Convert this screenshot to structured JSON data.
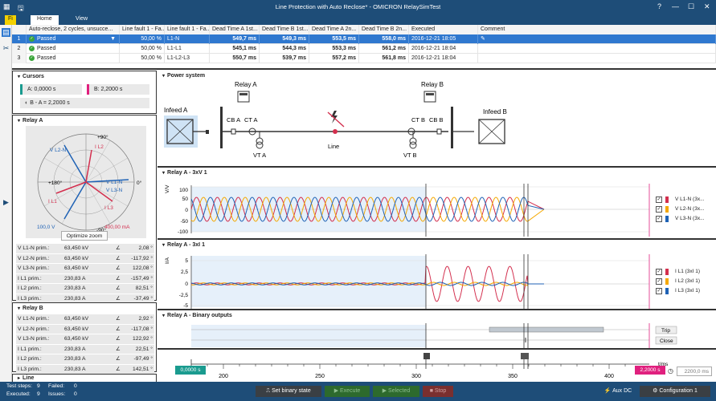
{
  "window": {
    "title": "Line Protection with Auto Reclose* - OMICRON RelaySimTest"
  },
  "ribbon": {
    "file": "Fi",
    "home": "Home",
    "view": "View",
    "file_hint": "F",
    "home_hint": "H",
    "view_hint": "V"
  },
  "grid": {
    "headers": [
      "Auto-reclose, 2 cycles, unsucce...",
      "Line fault 1 - Fa...",
      "Line fault 1 - Fa...",
      "Dead Time A 1st...",
      "Dead Time B 1st...",
      "Dead Time A 2n...",
      "Dead Time B 2n...",
      "Executed",
      "Comment"
    ],
    "rows": [
      {
        "num": "1",
        "status": "Passed",
        "c1": "50,00 %",
        "c2": "L1-N",
        "c3": "549,7 ms",
        "c4": "549,3 ms",
        "c5": "553,5 ms",
        "c6": "558,0 ms",
        "exec": "2016-12-21 18:05",
        "comment": ""
      },
      {
        "num": "2",
        "status": "Passed",
        "c1": "50,00 %",
        "c2": "L1-L1",
        "c3": "545,1 ms",
        "c4": "544,3 ms",
        "c5": "553,3 ms",
        "c6": "561,2 ms",
        "exec": "2016-12-21 18:04",
        "comment": ""
      },
      {
        "num": "3",
        "status": "Passed",
        "c1": "50,00 %",
        "c2": "L1-L2-L3",
        "c3": "550,7 ms",
        "c4": "539,7 ms",
        "c5": "557,2 ms",
        "c6": "561,8 ms",
        "exec": "2016-12-21 18:04",
        "comment": ""
      }
    ]
  },
  "cursors": {
    "title": "Cursors",
    "a": "A: 0,0000 s",
    "b": "B: 2,2000 s",
    "diff": "B - A = 2,2000 s"
  },
  "relay_a": {
    "title": "Relay A",
    "phasor": {
      "deg_0": "0°",
      "deg_90": "+90°",
      "deg_m90": "-90°",
      "deg_180": "+180°",
      "l1n": "V L1-N",
      "l2n": "V L2-N",
      "l3n": "V L3-N",
      "il1": "I L1",
      "il2": "I L2",
      "il3": "I L3",
      "vscale": "100,0 V",
      "iscale": "400,00 mA"
    },
    "optimize": "Optimize zoom",
    "values": [
      {
        "name": "V L1-N prim.:",
        "mag": "63,450 kV",
        "ang": "2,08 °"
      },
      {
        "name": "V L2-N prim.:",
        "mag": "63,450 kV",
        "ang": "-117,92 °"
      },
      {
        "name": "V L3-N prim.:",
        "mag": "63,450 kV",
        "ang": "122,08 °"
      },
      {
        "name": "I L1 prim.:",
        "mag": "230,83 A",
        "ang": "-157,49 °"
      },
      {
        "name": "I L2 prim.:",
        "mag": "230,83 A",
        "ang": "82,51 °"
      },
      {
        "name": "I L3 prim.:",
        "mag": "230,83 A",
        "ang": "-37,49 °"
      }
    ]
  },
  "relay_b": {
    "title": "Relay B",
    "values": [
      {
        "name": "V L1-N prim.:",
        "mag": "63,450 kV",
        "ang": "2,92 °"
      },
      {
        "name": "V L2-N prim.:",
        "mag": "63,450 kV",
        "ang": "-117,08 °"
      },
      {
        "name": "V L3-N prim.:",
        "mag": "63,450 kV",
        "ang": "122,92 °"
      },
      {
        "name": "I L1 prim.:",
        "mag": "230,83 A",
        "ang": "22,51 °"
      },
      {
        "name": "I L2 prim.:",
        "mag": "230,83 A",
        "ang": "-97,49 °"
      },
      {
        "name": "I L3 prim.:",
        "mag": "230,83 A",
        "ang": "142,51 °"
      }
    ]
  },
  "line_panel": {
    "title": "Line"
  },
  "power_system": {
    "title": "Power system",
    "relay_a": "Relay A",
    "relay_b": "Relay B",
    "infeed_a": "Infeed A",
    "infeed_b": "Infeed B",
    "cb_a": "CB A",
    "ct_a": "CT A",
    "ct_b": "CT B",
    "cb_b": "CB B",
    "vt_a": "VT A",
    "vt_b": "VT B",
    "line": "Line"
  },
  "voltage_chart": {
    "title": "Relay A - 3xV 1",
    "ylabel": "V/V",
    "yticks": [
      "100",
      "50",
      "0",
      "-50",
      "-100"
    ],
    "legend": [
      "V L1-N (3x...",
      "V L2-N (3x...",
      "V L3-N (3x..."
    ]
  },
  "current_chart": {
    "title": "Relay A - 3xI 1",
    "ylabel": "I/A",
    "yticks": [
      "5",
      "2,5",
      "0",
      "-2,5",
      "-5"
    ],
    "legend": [
      "I L1 (3xI 1)",
      "I L2 (3xI 1)",
      "I L3 (3xI 1)"
    ]
  },
  "binary_chart": {
    "title": "Relay A - Binary outputs",
    "trip": "Trip",
    "close": "Close"
  },
  "timeline": {
    "ticks": [
      "200",
      "250",
      "300",
      "350",
      "400"
    ],
    "unit": "t/ms",
    "cursor_a": "0,0000 s",
    "cursor_b": "2,2000 s",
    "field": "2200,0 ms"
  },
  "colors": {
    "l1": "#d32f4e",
    "l2": "#f5a800",
    "l3": "#1f62b5",
    "accent": "#1a9b8f",
    "magenta": "#e0207e"
  },
  "statusbar": {
    "steps_label": "Test steps:",
    "steps": "9",
    "failed_label": "Failed:",
    "failed": "0",
    "exec_label": "Executed:",
    "exec": "9",
    "issues_label": "Issues:",
    "issues": "0",
    "set_binary": "Set binary state",
    "execute": "Execute",
    "selected": "Selected",
    "stop": "Stop",
    "aux": "Aux DC",
    "config": "Configuration 1"
  }
}
